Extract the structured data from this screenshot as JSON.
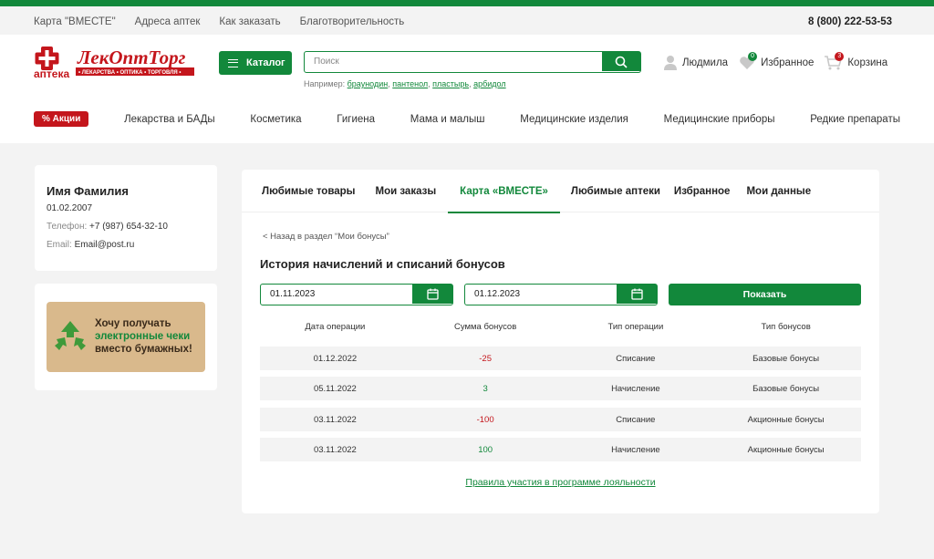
{
  "topbar": {
    "links": [
      "Карта \"ВМЕСТЕ\"",
      "Адреса аптек",
      "Как заказать",
      "Благотворительность"
    ],
    "phone": "8 (800) 222-53-53"
  },
  "logo": {
    "name": "ЛекОптТорг",
    "apteka": "аптека",
    "tagline": "• ЛЕКАРСТВА • ОПТИКА • ТОРГОВЛЯ •"
  },
  "header": {
    "catalog_label": "Каталог",
    "search_placeholder": "Поиск",
    "hint_prefix": "Например:",
    "hint_examples": [
      "браунодин",
      "пантенол",
      "пластырь",
      "арбидол"
    ],
    "user_name": "Людмила",
    "favorites_label": "Избранное",
    "favorites_count": "0",
    "cart_label": "Корзина",
    "cart_count": "3"
  },
  "nav": {
    "promo": "% Акции",
    "items": [
      "Лекарства и БАДы",
      "Косметика",
      "Гигиена",
      "Мама и малыш",
      "Медицинские изделия",
      "Медицинские приборы",
      "Редкие препараты"
    ]
  },
  "profile": {
    "name": "Имя Фамилия",
    "birthdate": "01.02.2007",
    "phone_label": "Телефон:",
    "phone": "+7 (987) 654-32-10",
    "email_label": "Email:",
    "email": "Email@post.ru"
  },
  "receipt_banner": {
    "line1": "Хочу получать",
    "line2": "электронные чеки",
    "line3": "вместо бумажных!"
  },
  "tabs": [
    {
      "label": "Любимые товары",
      "active": false
    },
    {
      "label": "Мои заказы",
      "active": false
    },
    {
      "label": "Карта «ВМЕСТЕ»",
      "active": true
    },
    {
      "label": "Любимые аптеки",
      "active": false
    },
    {
      "label": "Избранное",
      "active": false
    },
    {
      "label": "Мои данные",
      "active": false
    }
  ],
  "bonus": {
    "back_link": "< Назад в раздел “Мои бонусы”",
    "title": "История начислений и списаний бонусов",
    "date_from": "01.11.2023",
    "date_to": "01.12.2023",
    "show_label": "Показать",
    "columns": [
      "Дата операции",
      "Сумма бонусов",
      "Тип операции",
      "Тип бонусов"
    ],
    "rows": [
      {
        "date": "01.12.2022",
        "amount": "-25",
        "op": "Списание",
        "type": "Базовые бонусы"
      },
      {
        "date": "05.11.2022",
        "amount": "3",
        "op": "Начисление",
        "type": "Базовые бонусы"
      },
      {
        "date": "03.11.2022",
        "amount": "-100",
        "op": "Списание",
        "type": "Акционные бонусы"
      },
      {
        "date": "03.11.2022",
        "amount": "100",
        "op": "Начисление",
        "type": "Акционные бонусы"
      }
    ],
    "rules_link": "Правила участия в программе лояльности"
  },
  "colors": {
    "brand_green": "#12883b",
    "accent_red": "#c4161c"
  }
}
